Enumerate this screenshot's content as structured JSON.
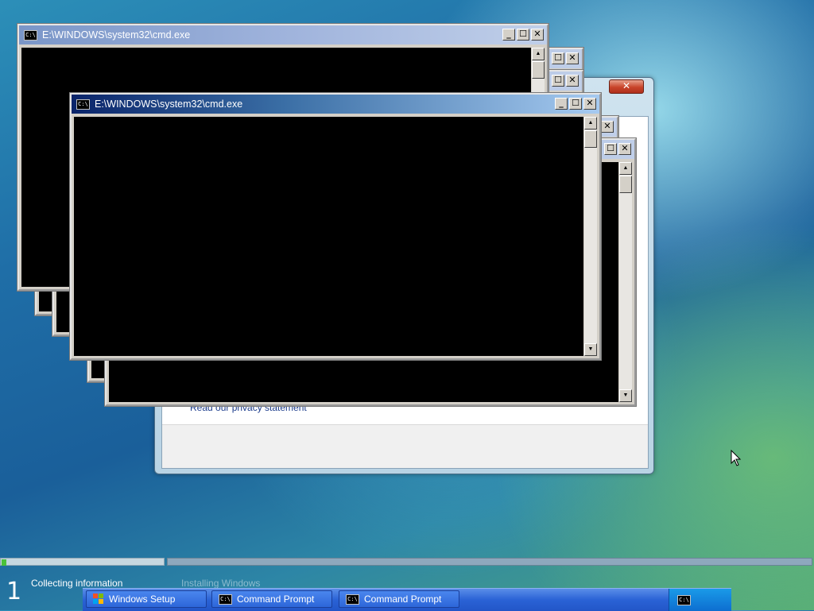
{
  "windows": {
    "cmd_title": "E:\\WINDOWS\\system32\\cmd.exe"
  },
  "icons": {
    "cmd_icon_text": "C:\\"
  },
  "setup": {
    "privacy_link": "Read our privacy statement",
    "close_glyph": "✕"
  },
  "status": {
    "step_number": "1",
    "step1": "Collecting information",
    "step2": "Installing Windows",
    "progress_fraction": 0.03
  },
  "taskbar": {
    "items": [
      {
        "label": "Windows Setup"
      },
      {
        "label": "Command Prompt"
      },
      {
        "label": "Command Prompt"
      }
    ]
  }
}
